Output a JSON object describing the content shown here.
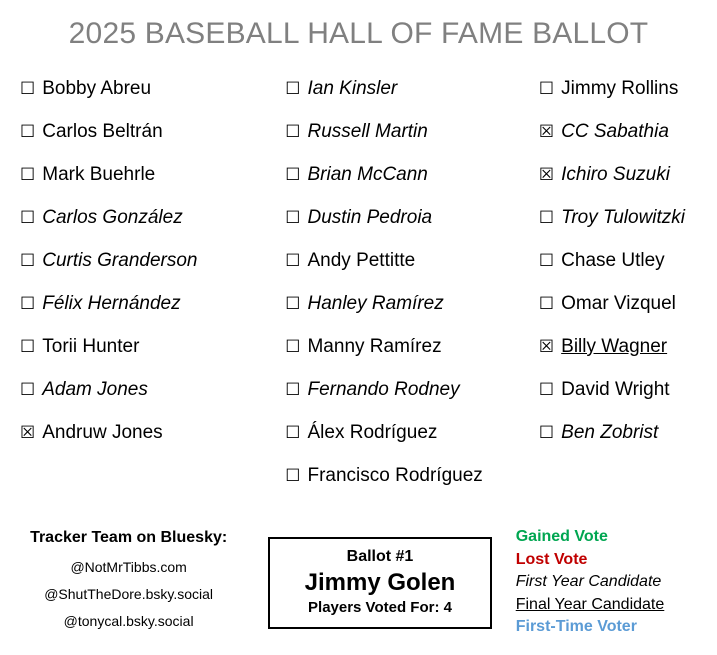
{
  "title": "2025 BASEBALL HALL OF FAME BALLOT",
  "checkbox": {
    "checked_glyph": "☒",
    "unchecked_glyph": "☐"
  },
  "columns": [
    {
      "id": "column-1",
      "candidates": [
        {
          "name": "Bobby Abreu",
          "checked": false,
          "first_year": false,
          "final_year": false
        },
        {
          "name": "Carlos Beltrán",
          "checked": false,
          "first_year": false,
          "final_year": false
        },
        {
          "name": "Mark Buehrle",
          "checked": false,
          "first_year": false,
          "final_year": false
        },
        {
          "name": "Carlos González",
          "checked": false,
          "first_year": true,
          "final_year": false
        },
        {
          "name": "Curtis Granderson",
          "checked": false,
          "first_year": true,
          "final_year": false
        },
        {
          "name": "Félix Hernández",
          "checked": false,
          "first_year": true,
          "final_year": false
        },
        {
          "name": "Torii Hunter",
          "checked": false,
          "first_year": false,
          "final_year": false
        },
        {
          "name": "Adam Jones",
          "checked": false,
          "first_year": true,
          "final_year": false
        },
        {
          "name": "Andruw Jones",
          "checked": true,
          "first_year": false,
          "final_year": false
        }
      ]
    },
    {
      "id": "column-2",
      "candidates": [
        {
          "name": "Ian Kinsler",
          "checked": false,
          "first_year": true,
          "final_year": false
        },
        {
          "name": "Russell Martin",
          "checked": false,
          "first_year": true,
          "final_year": false
        },
        {
          "name": "Brian McCann",
          "checked": false,
          "first_year": true,
          "final_year": false
        },
        {
          "name": "Dustin Pedroia",
          "checked": false,
          "first_year": true,
          "final_year": false
        },
        {
          "name": "Andy Pettitte",
          "checked": false,
          "first_year": false,
          "final_year": false
        },
        {
          "name": "Hanley Ramírez",
          "checked": false,
          "first_year": true,
          "final_year": false
        },
        {
          "name": "Manny Ramírez",
          "checked": false,
          "first_year": false,
          "final_year": false
        },
        {
          "name": "Fernando Rodney",
          "checked": false,
          "first_year": true,
          "final_year": false
        },
        {
          "name": "Álex Rodríguez",
          "checked": false,
          "first_year": false,
          "final_year": false
        },
        {
          "name": "Francisco Rodríguez",
          "checked": false,
          "first_year": false,
          "final_year": false
        }
      ]
    },
    {
      "id": "column-3",
      "candidates": [
        {
          "name": "Jimmy Rollins",
          "checked": false,
          "first_year": false,
          "final_year": false
        },
        {
          "name": "CC Sabathia",
          "checked": true,
          "first_year": true,
          "final_year": false
        },
        {
          "name": "Ichiro Suzuki",
          "checked": true,
          "first_year": true,
          "final_year": false
        },
        {
          "name": "Troy Tulowitzki",
          "checked": false,
          "first_year": true,
          "final_year": false
        },
        {
          "name": "Chase Utley",
          "checked": false,
          "first_year": false,
          "final_year": false
        },
        {
          "name": "Omar Vizquel",
          "checked": false,
          "first_year": false,
          "final_year": false
        },
        {
          "name": "Billy Wagner",
          "checked": true,
          "first_year": false,
          "final_year": true
        },
        {
          "name": "David Wright",
          "checked": false,
          "first_year": false,
          "final_year": false
        },
        {
          "name": "Ben Zobrist",
          "checked": false,
          "first_year": true,
          "final_year": false
        }
      ]
    }
  ],
  "footer": {
    "trackers": {
      "heading": "Tracker Team on Bluesky:",
      "handles": [
        "@NotMrTibbs.com",
        "@ShutTheDore.bsky.social",
        "@tonycal.bsky.social"
      ]
    },
    "ballot": {
      "number": "Ballot #1",
      "voter": "Jimmy Golen",
      "count": "Players Voted For: 4"
    },
    "legend": [
      {
        "label": "Gained Vote",
        "style": "gained",
        "color": "#00A651"
      },
      {
        "label": "Lost Vote",
        "style": "lost",
        "color": "#C00000"
      },
      {
        "label": "First Year Candidate",
        "style": "first-year",
        "color": "#000000"
      },
      {
        "label": "Final Year Candidate",
        "style": "final-year",
        "color": "#000000"
      },
      {
        "label": "First-Time Voter",
        "style": "first-time-voter",
        "color": "#5B9BD5"
      }
    ]
  }
}
